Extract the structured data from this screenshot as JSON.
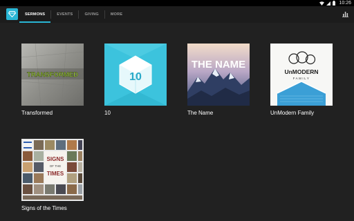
{
  "status_bar": {
    "time": "10:26"
  },
  "tabs": [
    {
      "label": "SERMONS",
      "active": true
    },
    {
      "label": "EVENTS",
      "active": false
    },
    {
      "label": "GIVING",
      "active": false
    },
    {
      "label": "MORE",
      "active": false
    }
  ],
  "sermons": [
    {
      "title": "Transformed",
      "art_text": "TRANSFORMED"
    },
    {
      "title": "10",
      "art_text": "10"
    },
    {
      "title": "The Name",
      "art_text": "THE NAME"
    },
    {
      "title": "UnModern Family",
      "art_text_1": "UnMODERN",
      "art_text_2": "FAMILY"
    },
    {
      "title": "Signs of the Times",
      "art_text_1": "SIGNS",
      "art_text_2": "OF THE",
      "art_text_3": "TIMES"
    }
  ],
  "colors": {
    "accent": "#29b6d5",
    "background": "#212121",
    "appbar": "#1c1c1c"
  },
  "icons": {
    "logo": "diamond-icon",
    "stats": "bar-chart-icon"
  }
}
